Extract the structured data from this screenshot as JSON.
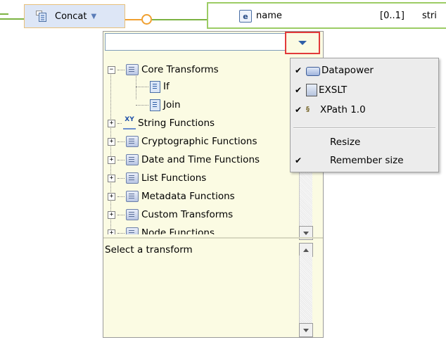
{
  "canvas": {
    "concat_label": "Concat",
    "field": {
      "icon_letter": "e",
      "name": "name",
      "cardinality": "[0..1]",
      "type_fragment": "stri"
    }
  },
  "popup": {
    "filter_placeholder": "",
    "tree": [
      {
        "label": "Core Transforms",
        "expanded": true,
        "icon": "folder-icon"
      },
      {
        "label": "If",
        "icon": "transform-icon"
      },
      {
        "label": "Join",
        "icon": "transform-icon"
      },
      {
        "label": "String Functions",
        "expanded": false,
        "icon": "xy-functions-icon"
      },
      {
        "label": "Cryptographic Functions",
        "expanded": false,
        "icon": "folder-icon"
      },
      {
        "label": "Date and Time Functions",
        "expanded": false,
        "icon": "calendar-icon"
      },
      {
        "label": "List Functions",
        "expanded": false,
        "icon": "folder-icon"
      },
      {
        "label": "Metadata Functions",
        "expanded": false,
        "icon": "folder-icon"
      },
      {
        "label": "Custom Transforms",
        "expanded": false,
        "icon": "folder-icon"
      },
      {
        "label": "Node Functions",
        "expanded": false,
        "icon": "folder-icon"
      }
    ],
    "description": "Select a transform"
  },
  "menu": {
    "items": [
      {
        "label": "Datapower",
        "checked": true,
        "icon": "datapower-icon"
      },
      {
        "label": "EXSLT",
        "checked": true,
        "icon": "exslt-icon"
      },
      {
        "label": "XPath 1.0",
        "checked": true,
        "icon": "xpath-icon"
      },
      {
        "label": "Resize",
        "checked": false
      },
      {
        "label": "Remember size",
        "checked": true
      }
    ],
    "check_glyph": "✔"
  },
  "colors": {
    "popup_bg": "#fbfbe3",
    "highlight_border": "#e23a3a",
    "menu_bg": "#ececec"
  }
}
